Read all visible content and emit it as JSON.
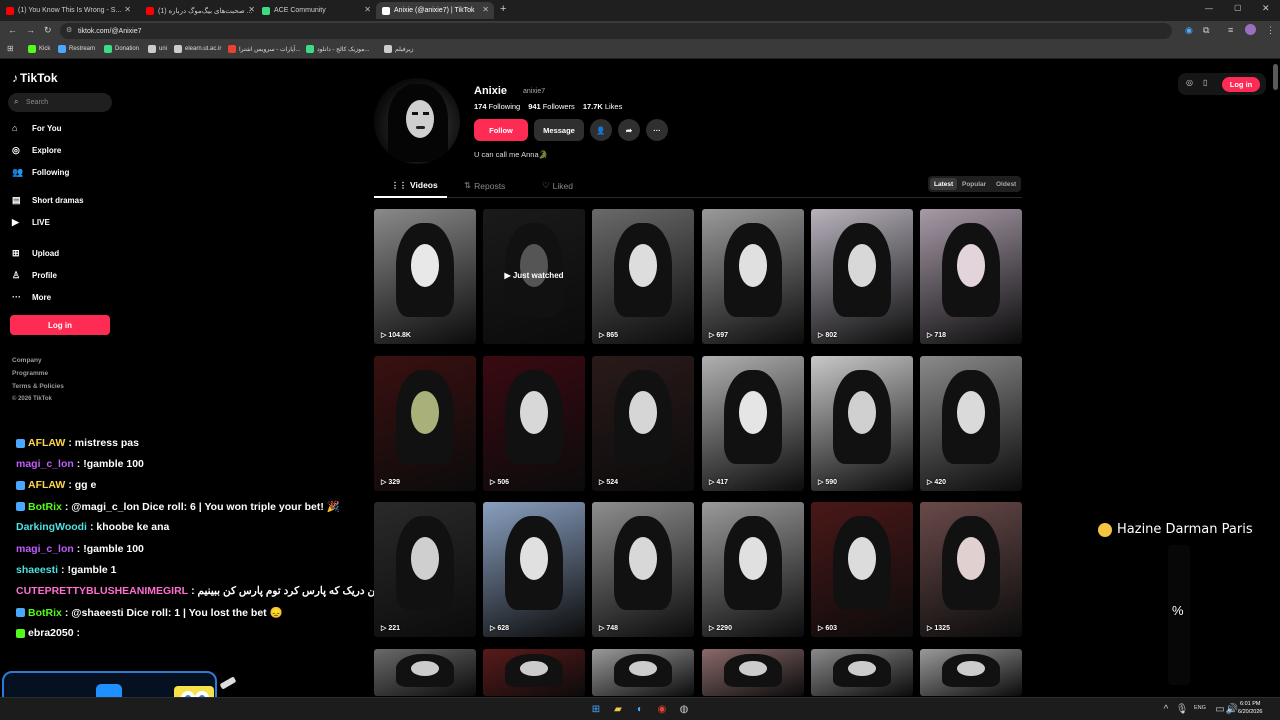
{
  "browser": {
    "tabs": [
      {
        "label": "(1) You Know This Is Wrong - S...",
        "color": "#ff0000",
        "active": false
      },
      {
        "label": "(1) صحبت‌های بیگ‌موگ درباره ...",
        "color": "#ff0000",
        "active": false
      },
      {
        "label": "ACE Community",
        "color": "#3ddc84",
        "active": false
      },
      {
        "label": "Anixie (@anixie7) | TikTok",
        "color": "#ffffff",
        "active": true
      }
    ],
    "new_tab": "+",
    "url": "tiktok.com/@Anixie7",
    "bookmarks": [
      "Kick",
      "Restream",
      "Donation",
      "uni",
      "elearn.ut.ac.ir",
      "آپارات - سرویس اشترا...",
      "موزیک کالج - دانلود...",
      "زیرفیلم"
    ]
  },
  "sidebar": {
    "logo": "TikTok",
    "search_placeholder": "Search",
    "nav": [
      {
        "label": "For You",
        "icon": "home-icon"
      },
      {
        "label": "Explore",
        "icon": "compass-icon"
      },
      {
        "label": "Following",
        "icon": "following-icon"
      },
      {
        "label": "Short dramas",
        "icon": "drama-icon"
      },
      {
        "label": "LIVE",
        "icon": "live-icon"
      },
      {
        "label": "Upload",
        "icon": "upload-icon"
      },
      {
        "label": "Profile",
        "icon": "profile-icon"
      },
      {
        "label": "More",
        "icon": "more-icon"
      }
    ],
    "login": "Log in",
    "footer": [
      "Company",
      "Programme",
      "Terms & Policies",
      "© 2026 TikTok"
    ]
  },
  "profile": {
    "name": "Anixie",
    "handle": "anixie7",
    "following_count": "174",
    "following_label": "Following",
    "followers_count": "941",
    "followers_label": "Followers",
    "likes_count": "17.7K",
    "likes_label": "Likes",
    "follow": "Follow",
    "message": "Message",
    "bio": "U can call me Anna🐊",
    "tabs": [
      "Videos",
      "Reposts",
      "Liked"
    ],
    "sort": [
      "Latest",
      "Popular",
      "Oldest"
    ],
    "just_watched": "Just watched"
  },
  "videos": [
    {
      "views": "104.8K",
      "bg": "#8a8a8a",
      "face": "#e8e8e8"
    },
    {
      "views": "",
      "bg": "#1a1a1a",
      "face": "#555555"
    },
    {
      "views": "865",
      "bg": "#6a6a6a",
      "face": "#dddddd"
    },
    {
      "views": "697",
      "bg": "#9a9a9a",
      "face": "#e0e0e0"
    },
    {
      "views": "802",
      "bg": "#b8b2bd",
      "face": "#d8d8d8"
    },
    {
      "views": "718",
      "bg": "#a89aa8",
      "face": "#e2d4da"
    },
    {
      "views": "329",
      "bg": "#3a1010",
      "face": "#a9b07a"
    },
    {
      "views": "506",
      "bg": "#3a0a12",
      "face": "#d8d8d8"
    },
    {
      "views": "524",
      "bg": "#2a1a1a",
      "face": "#d6d6d6"
    },
    {
      "views": "417",
      "bg": "#b0b0b0",
      "face": "#e5e5e5"
    },
    {
      "views": "590",
      "bg": "#c8c8c8",
      "face": "#d0d0d0"
    },
    {
      "views": "420",
      "bg": "#8a8a8a",
      "face": "#dadada"
    },
    {
      "views": "221",
      "bg": "#2a2a2a",
      "face": "#cfcfcf"
    },
    {
      "views": "628",
      "bg": "#8aa0c0",
      "face": "#e0e0e0"
    },
    {
      "views": "748",
      "bg": "#8e8e8e",
      "face": "#d8d8d8"
    },
    {
      "views": "2290",
      "bg": "#9a9a9a",
      "face": "#e0e0e0"
    },
    {
      "views": "603",
      "bg": "#4a1818",
      "face": "#dcdcdc"
    },
    {
      "views": "1325",
      "bg": "#6a4a4a",
      "face": "#e0d0d0"
    },
    {
      "views": "",
      "bg": "#6a6a6a",
      "face": "#cccccc"
    },
    {
      "views": "",
      "bg": "#5a1a1a",
      "face": "#cccccc"
    },
    {
      "views": "",
      "bg": "#9a9a9a",
      "face": "#cccccc"
    },
    {
      "views": "",
      "bg": "#8a6a6a",
      "face": "#cccccc"
    },
    {
      "views": "",
      "bg": "#8a8a8a",
      "face": "#cccccc"
    },
    {
      "views": "",
      "bg": "#9a9a9a",
      "face": "#cccccc"
    }
  ],
  "top_right": {
    "login": "Log in"
  },
  "chat": [
    {
      "user": "AFLAW",
      "msg": ": mistress pas",
      "color": "#ffd54a",
      "badge": "#4aa8ff"
    },
    {
      "user": "magi_c_lon",
      "msg": ": !gamble 100",
      "color": "#c15cff",
      "badge": ""
    },
    {
      "user": "AFLAW",
      "msg": ": gg e",
      "color": "#ffd54a",
      "badge": "#4aa8ff"
    },
    {
      "user": "BotRix",
      "msg": ": @magi_c_lon Dice roll: 6 | You won triple your bet! 🎉",
      "color": "#53fc18",
      "badge": "#4aa8ff"
    },
    {
      "user": "DarkingWoodi",
      "msg": ": khoobe ke ana",
      "color": "#4fe0e0",
      "badge": ""
    },
    {
      "user": "magi_c_lon",
      "msg": ": !gamble 100",
      "color": "#c15cff",
      "badge": ""
    },
    {
      "user": "shaeesti",
      "msg": ": !gamble 1",
      "color": "#4fe0e0",
      "badge": ""
    },
    {
      "user": "CUTEPRETTYBLUSHEANIMEGIRL",
      "msg": ": اینتن عین دریک که پارس کرد توم پارس کن ببینیم",
      "color": "#ff6fd0",
      "badge": ""
    },
    {
      "user": "BotRix",
      "msg": ": @shaeesti Dice roll: 1 | You lost the bet 😞",
      "color": "#53fc18",
      "badge": "#4aa8ff"
    },
    {
      "user": "ebra2050",
      "msg": ":",
      "color": "#ffffff",
      "badge": "#53fc18"
    }
  ],
  "overlay": {
    "music": "Hazine Darman Paris",
    "percent": "%"
  },
  "taskbar": {
    "lang": "ENG",
    "time": "6:01 PM",
    "date": "6/20/2026"
  }
}
